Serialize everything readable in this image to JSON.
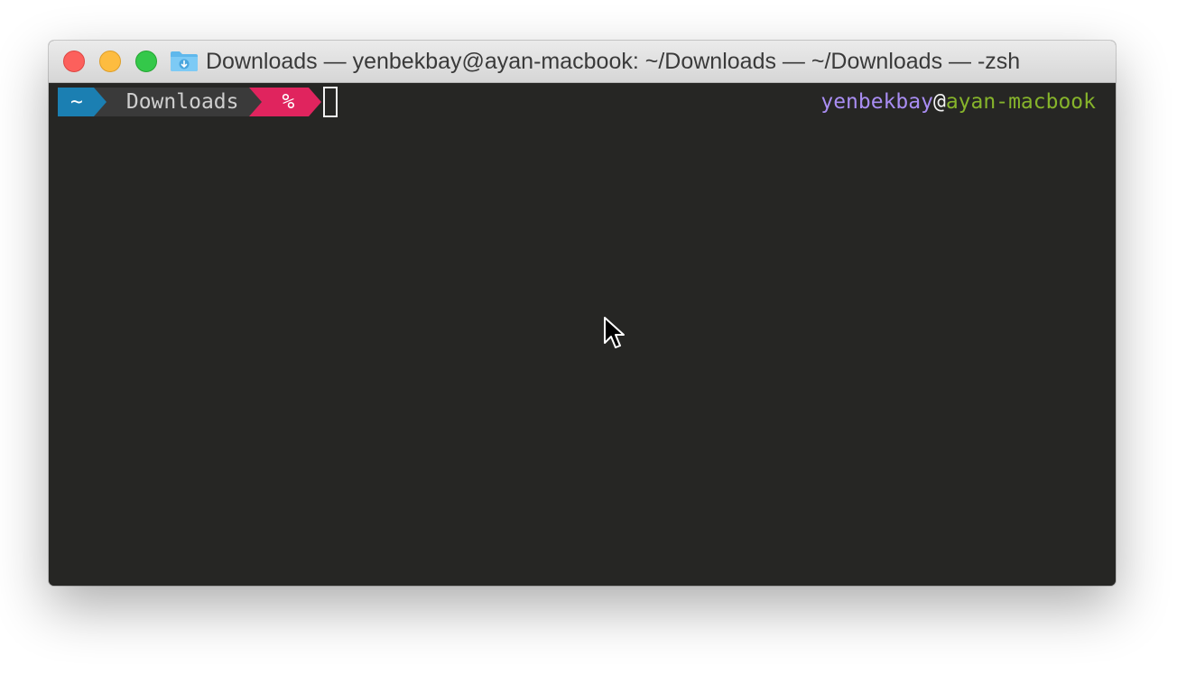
{
  "window": {
    "title": "Downloads — yenbekbay@ayan-macbook: ~/Downloads — ~/Downloads — -zsh",
    "title_icon": "folder-downloads-icon"
  },
  "prompt": {
    "home_segment": "~",
    "dir_segment": "Downloads",
    "symbol_segment": "%",
    "colors": {
      "home_bg": "#1b7fb2",
      "dir_bg": "#3a3a3a",
      "symbol_bg": "#e0245e"
    }
  },
  "rprompt": {
    "user": "yenbekbay",
    "at": "@",
    "host": "ayan-macbook",
    "colors": {
      "user": "#a98df2",
      "host": "#86b42b"
    }
  },
  "terminal": {
    "background": "#262624",
    "cursor_style": "block-outline"
  },
  "mouse_pointer": "arrow-cursor-icon"
}
